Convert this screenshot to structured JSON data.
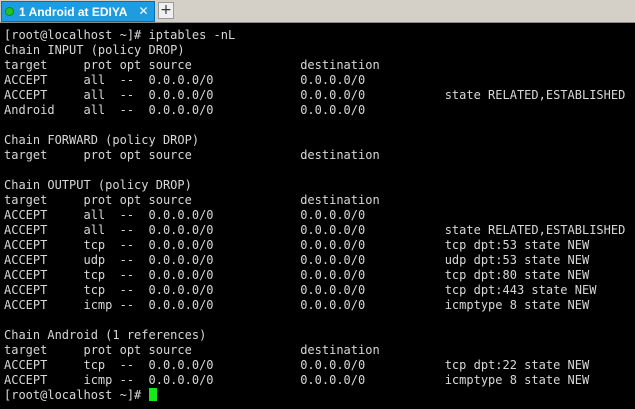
{
  "tabs": [
    {
      "label": "1 Android at EDIYA",
      "status_color": "#22c326",
      "active": true,
      "close_icon": "close-icon"
    }
  ],
  "new_tab_label": "+",
  "colors": {
    "active_tab": "#1f9be0",
    "terminal_bg": "#000000",
    "terminal_fg": "#d8d8d8",
    "cursor": "#18e818"
  },
  "terminal": {
    "lines": [
      "[root@localhost ~]# iptables -nL",
      "Chain INPUT (policy DROP)",
      "target     prot opt source               destination",
      "ACCEPT     all  --  0.0.0.0/0            0.0.0.0/0",
      "ACCEPT     all  --  0.0.0.0/0            0.0.0.0/0           state RELATED,ESTABLISHED",
      "Android    all  --  0.0.0.0/0            0.0.0.0/0",
      "",
      "Chain FORWARD (policy DROP)",
      "target     prot opt source               destination",
      "",
      "Chain OUTPUT (policy DROP)",
      "target     prot opt source               destination",
      "ACCEPT     all  --  0.0.0.0/0            0.0.0.0/0",
      "ACCEPT     all  --  0.0.0.0/0            0.0.0.0/0           state RELATED,ESTABLISHED",
      "ACCEPT     tcp  --  0.0.0.0/0            0.0.0.0/0           tcp dpt:53 state NEW",
      "ACCEPT     udp  --  0.0.0.0/0            0.0.0.0/0           udp dpt:53 state NEW",
      "ACCEPT     tcp  --  0.0.0.0/0            0.0.0.0/0           tcp dpt:80 state NEW",
      "ACCEPT     tcp  --  0.0.0.0/0            0.0.0.0/0           tcp dpt:443 state NEW",
      "ACCEPT     icmp --  0.0.0.0/0            0.0.0.0/0           icmptype 8 state NEW",
      "",
      "Chain Android (1 references)",
      "target     prot opt source               destination",
      "ACCEPT     tcp  --  0.0.0.0/0            0.0.0.0/0           tcp dpt:22 state NEW",
      "ACCEPT     icmp --  0.0.0.0/0            0.0.0.0/0           icmptype 8 state NEW"
    ],
    "prompt": "[root@localhost ~]# "
  }
}
